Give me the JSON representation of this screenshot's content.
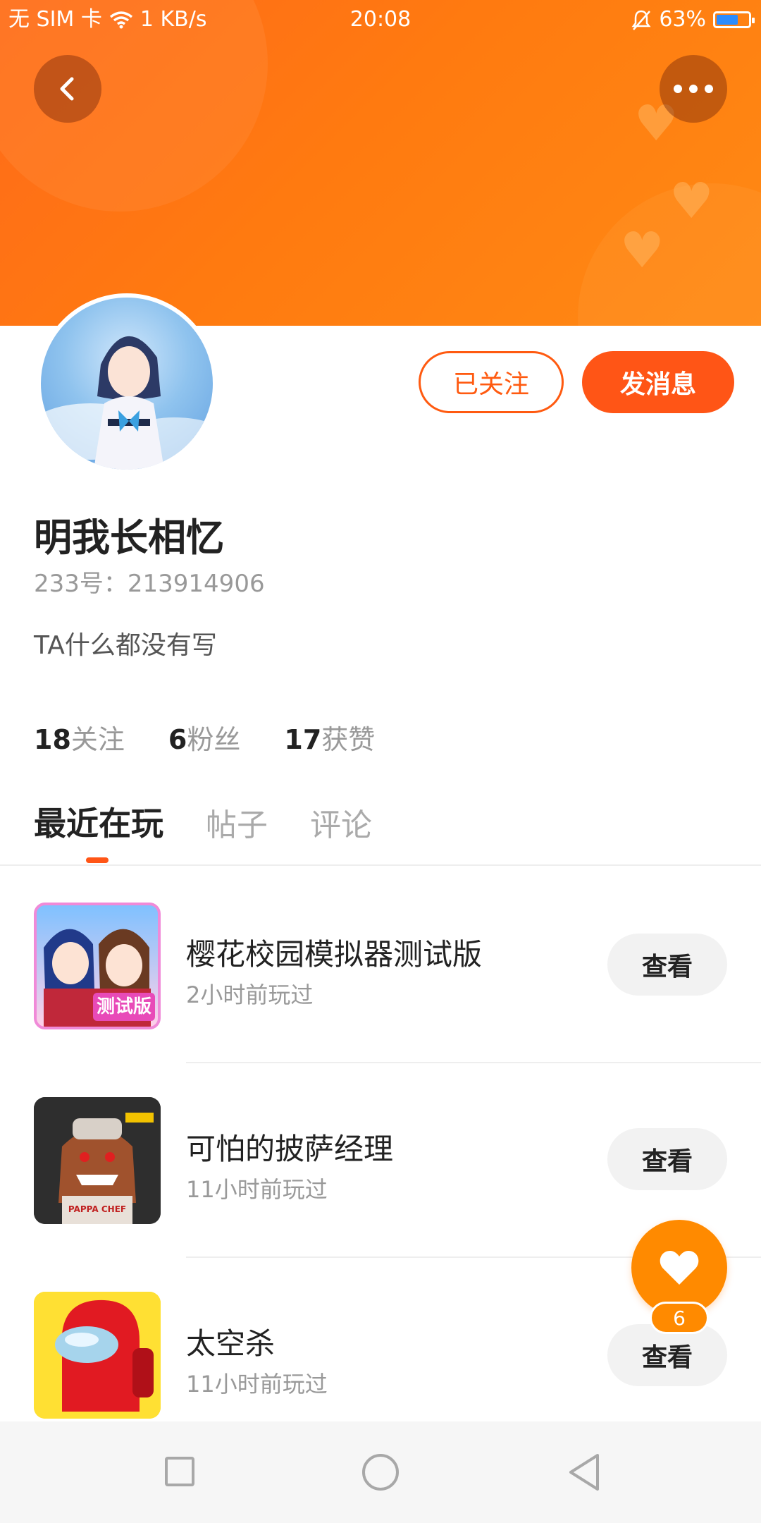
{
  "status_bar": {
    "sim": "无 SIM 卡",
    "speed": "1 KB/s",
    "time": "20:08",
    "battery": "63%"
  },
  "profile": {
    "follow_button": "已关注",
    "message_button": "发消息",
    "username": "明我长相忆",
    "uid": "233号：213914906",
    "bio": "TA什么都没有写"
  },
  "stats": [
    {
      "num": "18",
      "label": "关注"
    },
    {
      "num": "6",
      "label": "粉丝"
    },
    {
      "num": "17",
      "label": "获赞"
    }
  ],
  "tabs": [
    "最近在玩",
    "帖子",
    "评论"
  ],
  "games": [
    {
      "title": "樱花校园模拟器测试版",
      "time": "2小时前玩过",
      "button": "查看",
      "badge": "测试版"
    },
    {
      "title": "可怕的披萨经理",
      "time": "11小时前玩过",
      "button": "查看",
      "badge": "PAPPA CHEF"
    },
    {
      "title": "太空杀",
      "time": "11小时前玩过",
      "button": "查看"
    }
  ],
  "like_count": "6",
  "colors": {
    "accent": "#ff5516",
    "banner": "#ff7a10",
    "fab": "#ff8a00"
  }
}
